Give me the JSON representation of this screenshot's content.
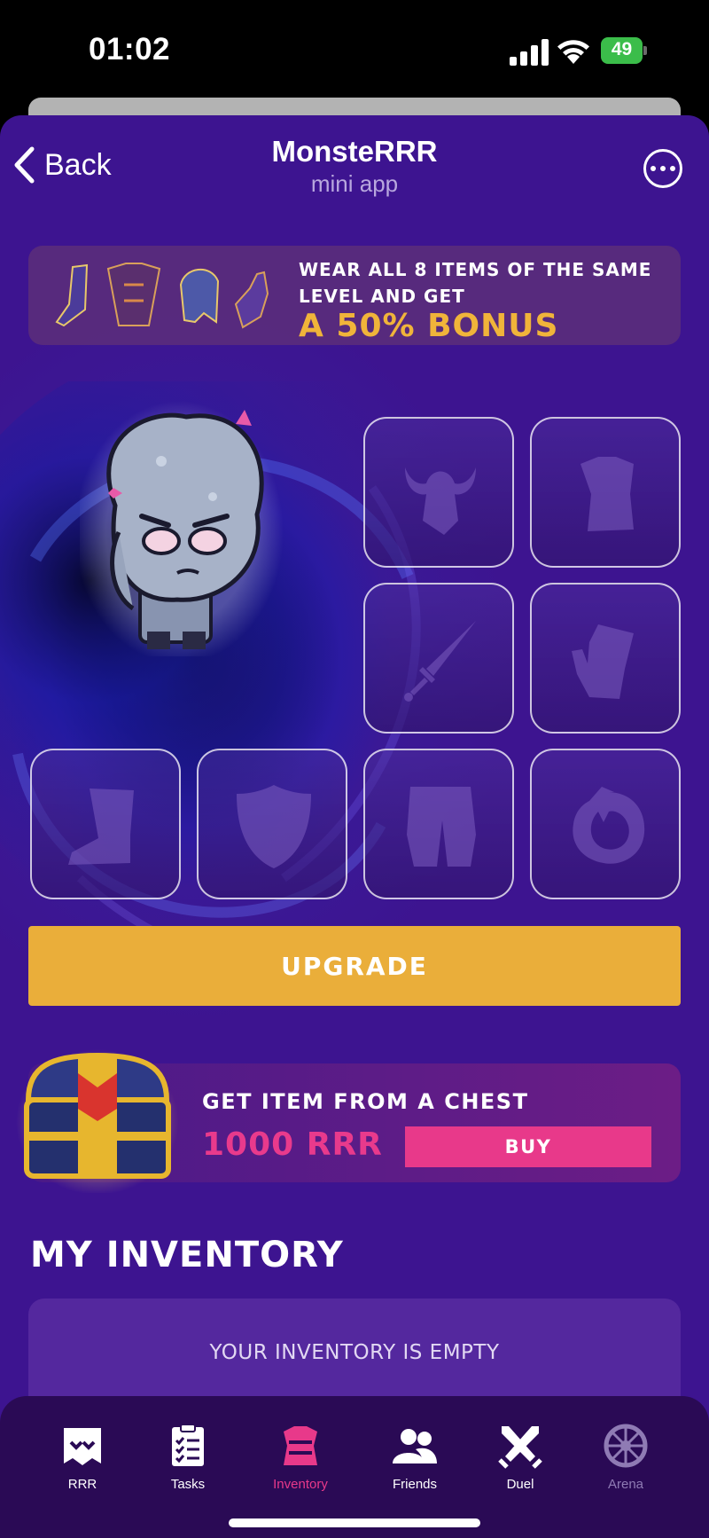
{
  "status_bar": {
    "time": "01:02",
    "battery_percent": "49"
  },
  "header": {
    "back_label": "Back",
    "title": "MonsteRRR",
    "subtitle": "mini app"
  },
  "bonus_banner": {
    "text": "WEAR ALL 8 ITEMS OF THE SAME LEVEL AND GET",
    "highlight": "A 50% BONUS",
    "item_icons": [
      "boot-icon",
      "armor-icon",
      "helmet-icon",
      "gauntlet-icon"
    ]
  },
  "equipment_slots": [
    {
      "name": "helmet",
      "icon": "horned-helmet-icon"
    },
    {
      "name": "armor",
      "icon": "armor-icon"
    },
    {
      "name": "weapon",
      "icon": "sword-icon"
    },
    {
      "name": "gloves",
      "icon": "glove-icon"
    },
    {
      "name": "boots",
      "icon": "boot-icon"
    },
    {
      "name": "shield",
      "icon": "shield-icon"
    },
    {
      "name": "pants",
      "icon": "pants-icon"
    },
    {
      "name": "ring",
      "icon": "ring-icon"
    }
  ],
  "upgrade_button": {
    "label": "UPGRADE"
  },
  "chest_offer": {
    "title": "GET ITEM FROM A CHEST",
    "price": "1000 RRR",
    "buy_label": "BUY"
  },
  "inventory": {
    "heading": "MY INVENTORY",
    "empty_message": "YOUR INVENTORY IS EMPTY"
  },
  "tabs": [
    {
      "label": "RRR",
      "icon": "monster-icon",
      "state": "normal"
    },
    {
      "label": "Tasks",
      "icon": "clipboard-icon",
      "state": "normal"
    },
    {
      "label": "Inventory",
      "icon": "armor-icon",
      "state": "active"
    },
    {
      "label": "Friends",
      "icon": "friends-icon",
      "state": "normal"
    },
    {
      "label": "Duel",
      "icon": "crossed-swords-icon",
      "state": "normal"
    },
    {
      "label": "Arena",
      "icon": "wheel-icon",
      "state": "disabled"
    }
  ],
  "colors": {
    "background_purple": "#3d1490",
    "accent_gold": "#eaae3a",
    "accent_pink": "#e8398a",
    "bonus_gold": "#f0b43a",
    "tabbar": "#2a0a55"
  }
}
